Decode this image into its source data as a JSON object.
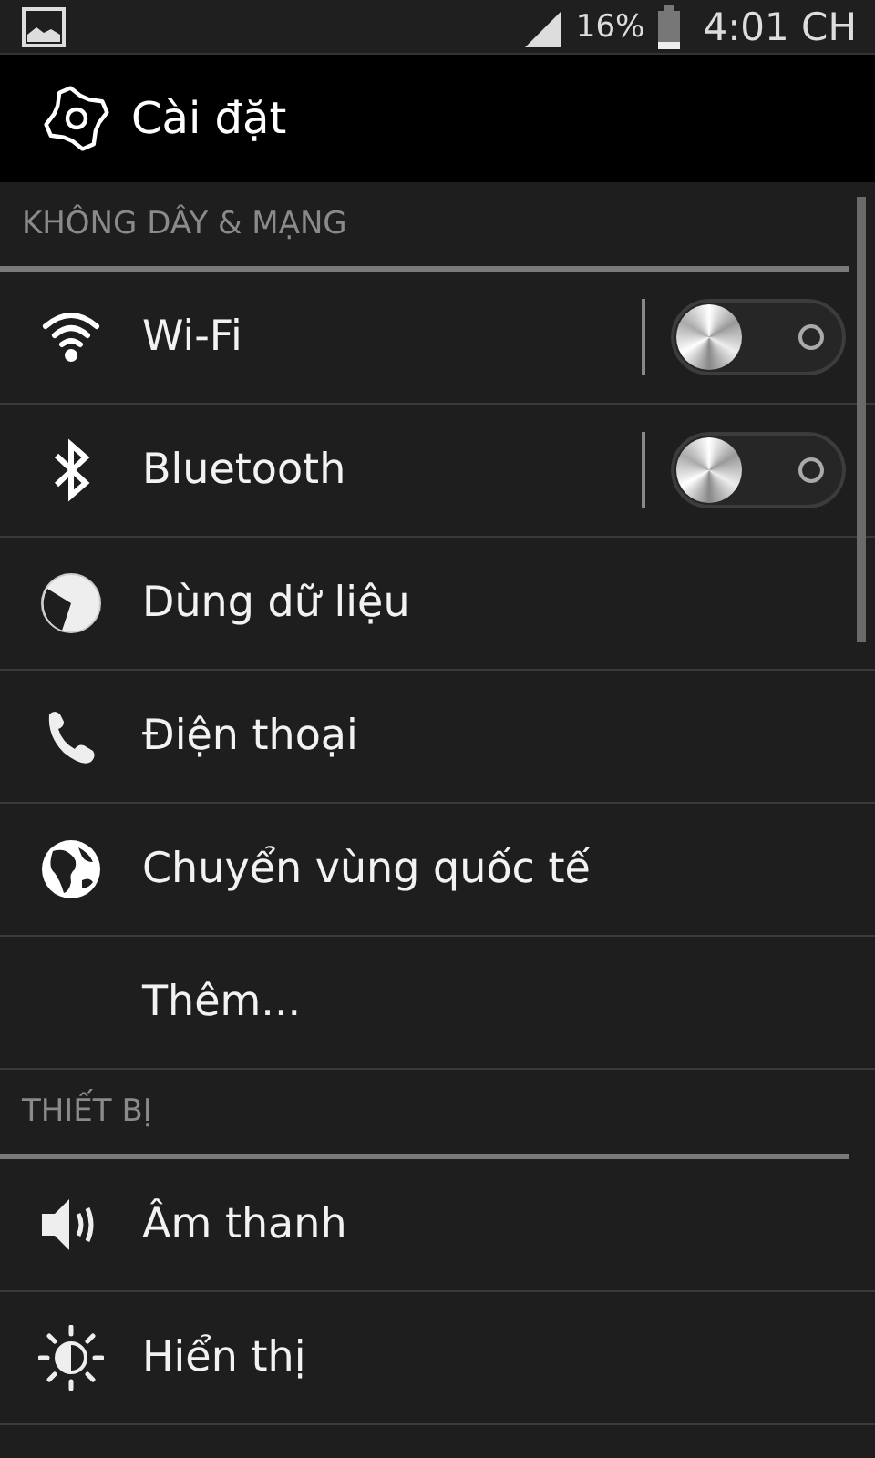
{
  "status_bar": {
    "battery": "16%",
    "time": "4:01 CH"
  },
  "header": {
    "title": "Cài đặt"
  },
  "sections": [
    {
      "title": "KHÔNG DÂY & MẠNG",
      "items": [
        {
          "label": "Wi-Fi",
          "kind": "toggle",
          "checked": false
        },
        {
          "label": "Bluetooth",
          "kind": "toggle",
          "checked": false
        },
        {
          "label": "Dùng dữ liệu",
          "kind": "plain"
        },
        {
          "label": "Điện thoại",
          "kind": "plain"
        },
        {
          "label": "Chuyển vùng quốc tế",
          "kind": "plain"
        },
        {
          "label": "Thêm...",
          "kind": "plain"
        }
      ]
    },
    {
      "title": "THIẾT BỊ",
      "items": [
        {
          "label": "Âm thanh",
          "kind": "plain"
        },
        {
          "label": "Hiển thị",
          "kind": "plain"
        }
      ]
    }
  ]
}
